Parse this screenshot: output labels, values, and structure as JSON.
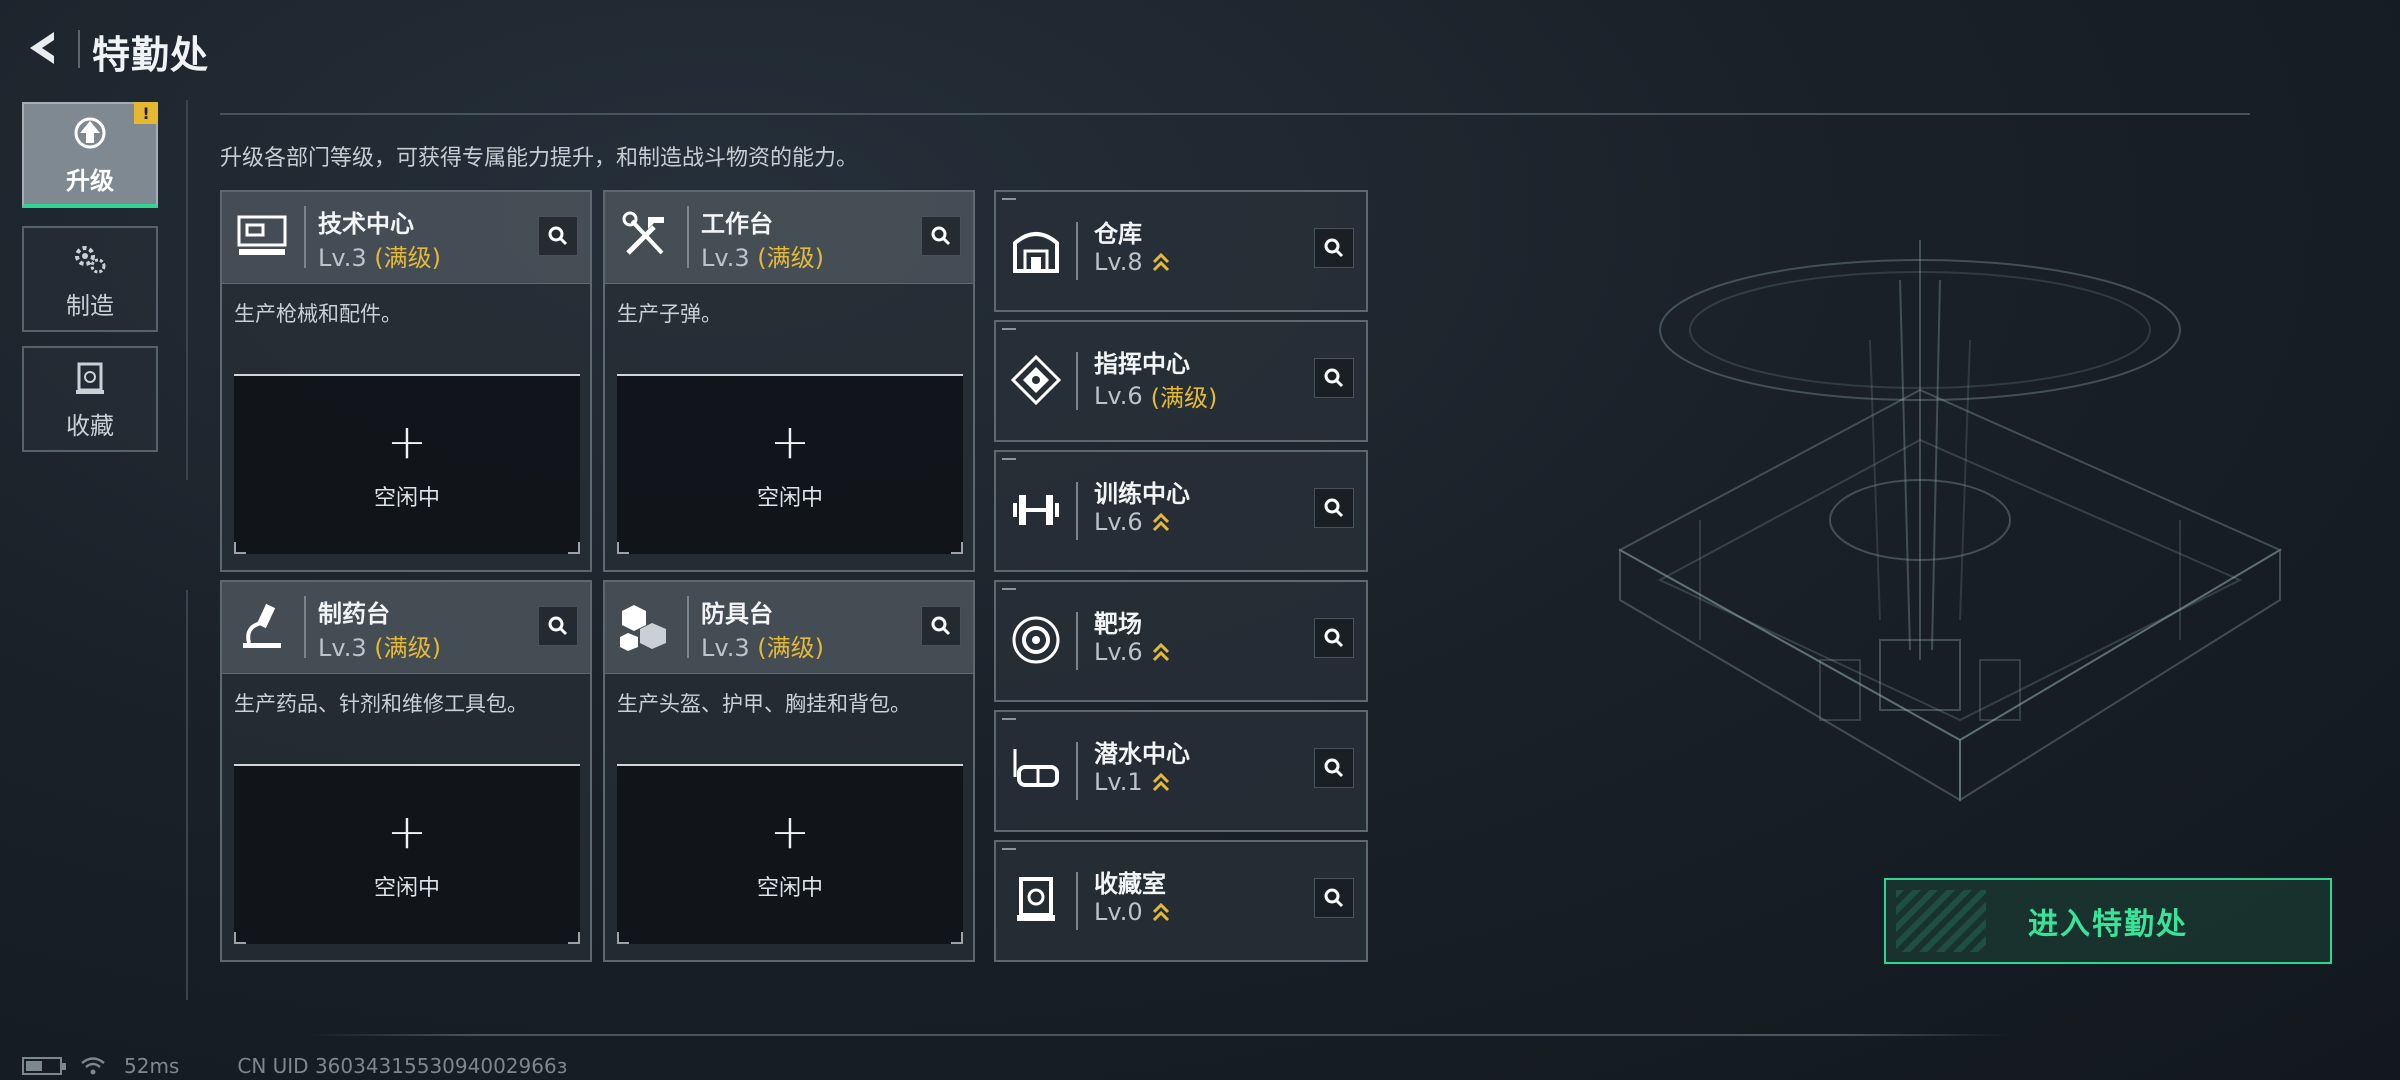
{
  "header": {
    "title": "特勤处"
  },
  "sidebar": {
    "tabs": [
      {
        "label": "升级",
        "active": true,
        "badge": "!"
      },
      {
        "label": "制造",
        "active": false
      },
      {
        "label": "收藏",
        "active": false
      }
    ]
  },
  "main": {
    "subtitle": "升级各部门等级，可获得专属能力提升，和制造战斗物资的能力。",
    "stations": [
      {
        "name": "技术中心",
        "level": "Lv.3",
        "max_tag": "(满级)",
        "desc": "生产枪械和配件。",
        "slot_plus": "+",
        "slot_status": "空闲中",
        "icon": "computer-icon"
      },
      {
        "name": "工作台",
        "level": "Lv.3",
        "max_tag": "(满级)",
        "desc": "生产子弹。",
        "slot_plus": "+",
        "slot_status": "空闲中",
        "icon": "tools-icon"
      },
      {
        "name": "制药台",
        "level": "Lv.3",
        "max_tag": "(满级)",
        "desc": "生产药品、针剂和维修工具包。",
        "slot_plus": "+",
        "slot_status": "空闲中",
        "icon": "microscope-icon"
      },
      {
        "name": "防具台",
        "level": "Lv.3",
        "max_tag": "(满级)",
        "desc": "生产头盔、护甲、胸挂和背包。",
        "slot_plus": "+",
        "slot_status": "空闲中",
        "icon": "armor-blocks-icon"
      }
    ],
    "facilities": [
      {
        "name": "仓库",
        "level": "Lv.8",
        "max_tag": "",
        "upgradable": true,
        "icon": "warehouse-icon"
      },
      {
        "name": "指挥中心",
        "level": "Lv.6",
        "max_tag": "(满级)",
        "upgradable": false,
        "icon": "chip-icon"
      },
      {
        "name": "训练中心",
        "level": "Lv.6",
        "max_tag": "",
        "upgradable": true,
        "icon": "dumbbell-icon"
      },
      {
        "name": "靶场",
        "level": "Lv.6",
        "max_tag": "",
        "upgradable": true,
        "icon": "target-icon"
      },
      {
        "name": "潜水中心",
        "level": "Lv.1",
        "max_tag": "",
        "upgradable": true,
        "icon": "diving-mask-icon"
      },
      {
        "name": "收藏室",
        "level": "Lv.0",
        "max_tag": "",
        "upgradable": true,
        "icon": "display-case-icon"
      }
    ],
    "enter_button": "进入特勤处"
  },
  "status_bar": {
    "ping": "52ms",
    "uid": "CN UID 3603431553094002966з"
  },
  "colors": {
    "accent_green": "#2fd68f",
    "max_gold": "#e4b93a",
    "alert_yellow": "#e5b832"
  }
}
